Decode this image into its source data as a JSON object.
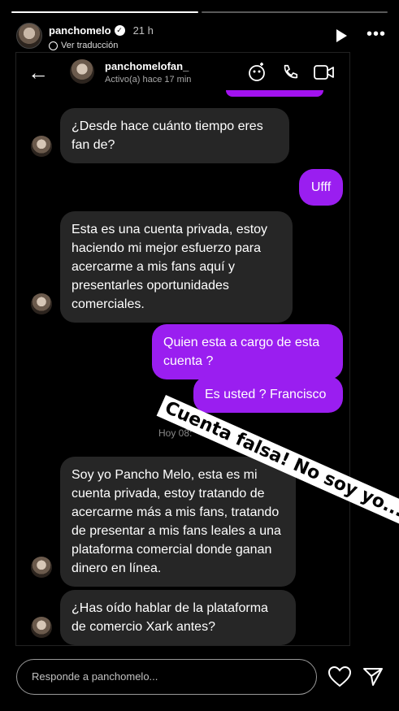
{
  "story": {
    "progress": [
      1.0,
      0.0
    ],
    "username": "panchomelo",
    "verified_mark": "✓",
    "time": "21 h",
    "translate": "Ver traducción",
    "icons": [
      "play-icon",
      "more-icon"
    ]
  },
  "dm": {
    "name": "panchomelofan_",
    "status": "Activo(a) hace 17 min",
    "messages": [
      {
        "side": "in",
        "text": "¿Desde hace cuánto tiempo eres fan de?"
      },
      {
        "side": "out",
        "text": "Ufff"
      },
      {
        "side": "in",
        "text": "Esta es una cuenta privada, estoy haciendo mi mejor esfuerzo para acercarme a mis fans aquí y presentarles oportunidades comerciales."
      },
      {
        "side": "out",
        "text": "Quien esta a cargo de esta cuenta ?"
      },
      {
        "side": "out",
        "text": "Es usted ? Francisco"
      },
      {
        "side": "in",
        "text": "Soy yo Pancho Melo, esta es mi cuenta privada, estoy tratando de acercarme más a mis fans, tratando de presentar a mis fans leales a una plataforma comercial donde ganan dinero en línea."
      },
      {
        "side": "in",
        "text": "¿Has oído hablar de la plataforma de comercio Xark antes?"
      }
    ],
    "timestamp": "Hoy 08:",
    "accent_color": "#9a1ef0"
  },
  "sticker": {
    "line1": "Cuenta falsa! No soy yo..."
  },
  "reply": {
    "placeholder": "Responde a panchomelo..."
  }
}
